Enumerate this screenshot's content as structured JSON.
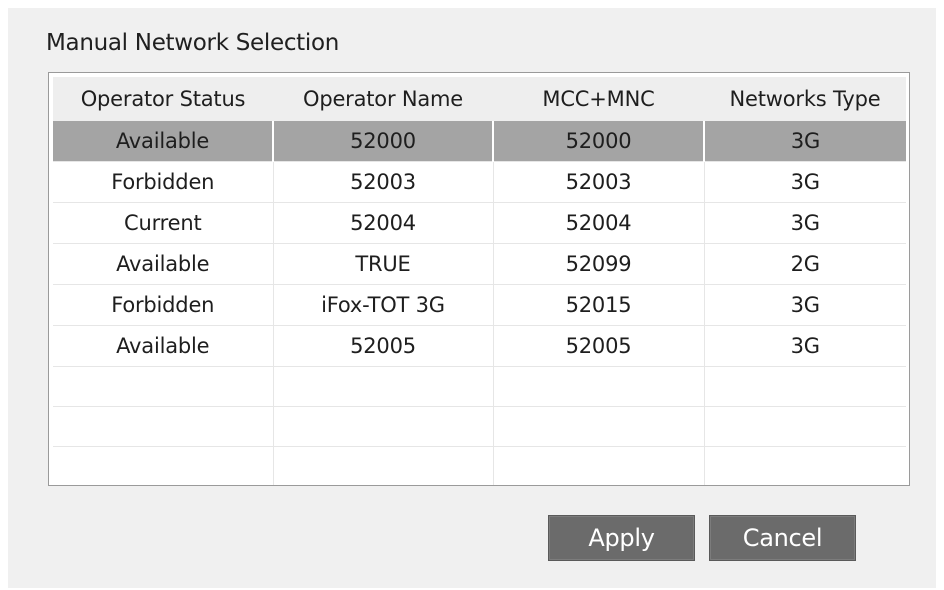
{
  "dialog": {
    "title": "Manual Network Selection"
  },
  "table": {
    "columns": [
      "Operator Status",
      "Operator Name",
      "MCC+MNC",
      "Networks Type"
    ],
    "selected_row": 0,
    "rows": [
      [
        "Available",
        "52000",
        "52000",
        "3G"
      ],
      [
        "Forbidden",
        "52003",
        "52003",
        "3G"
      ],
      [
        "Current",
        "52004",
        "52004",
        "3G"
      ],
      [
        "Available",
        "TRUE",
        "52099",
        "2G"
      ],
      [
        "Forbidden",
        "iFox-TOT 3G",
        "52015",
        "3G"
      ],
      [
        "Available",
        "52005",
        "52005",
        "3G"
      ]
    ]
  },
  "buttons": {
    "apply_label": "Apply",
    "cancel_label": "Cancel"
  },
  "colors": {
    "background": "#f0f0f0",
    "selected_row": "#a4a4a4",
    "button": "#6b6b6b"
  }
}
